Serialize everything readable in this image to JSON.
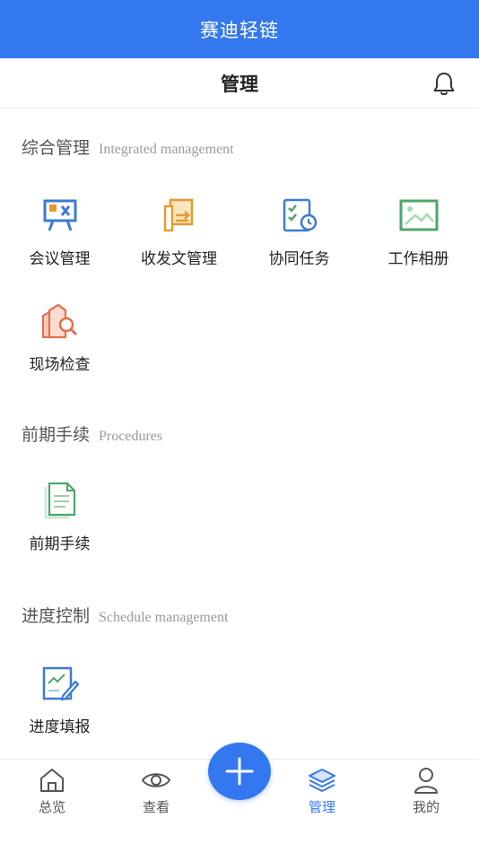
{
  "app": {
    "title": "赛迪轻链"
  },
  "header": {
    "title": "管理",
    "bell_icon": "bell-icon"
  },
  "sections": [
    {
      "title": "综合管理",
      "subtitle": "Integrated management",
      "items": [
        {
          "label": "会议管理",
          "icon": "meeting-board-icon",
          "color": "#3a7bd5"
        },
        {
          "label": "收发文管理",
          "icon": "document-exchange-icon",
          "color": "#e59a2f"
        },
        {
          "label": "协同任务",
          "icon": "task-clock-icon",
          "color": "#3a7bd5"
        },
        {
          "label": "工作相册",
          "icon": "photo-album-icon",
          "color": "#4ea66b"
        },
        {
          "label": "现场检查",
          "icon": "site-inspection-icon",
          "color": "#e0704a"
        }
      ]
    },
    {
      "title": "前期手续",
      "subtitle": "Procedures",
      "items": [
        {
          "label": "前期手续",
          "icon": "procedure-document-icon",
          "color": "#4ea66b"
        }
      ]
    },
    {
      "title": "进度控制",
      "subtitle": "Schedule management",
      "items": [
        {
          "label": "进度填报",
          "icon": "progress-report-icon",
          "color": "#3a7bd5"
        }
      ]
    }
  ],
  "tabbar": {
    "tabs": [
      {
        "label": "总览",
        "icon": "home-icon",
        "active": false
      },
      {
        "label": "查看",
        "icon": "eye-icon",
        "active": false
      },
      {
        "label": "管理",
        "icon": "layers-icon",
        "active": true
      },
      {
        "label": "我的",
        "icon": "user-icon",
        "active": false
      }
    ],
    "fab_icon": "plus-icon"
  },
  "colors": {
    "primary": "#3478f0",
    "text": "#222222",
    "muted": "#9a9a9a"
  }
}
